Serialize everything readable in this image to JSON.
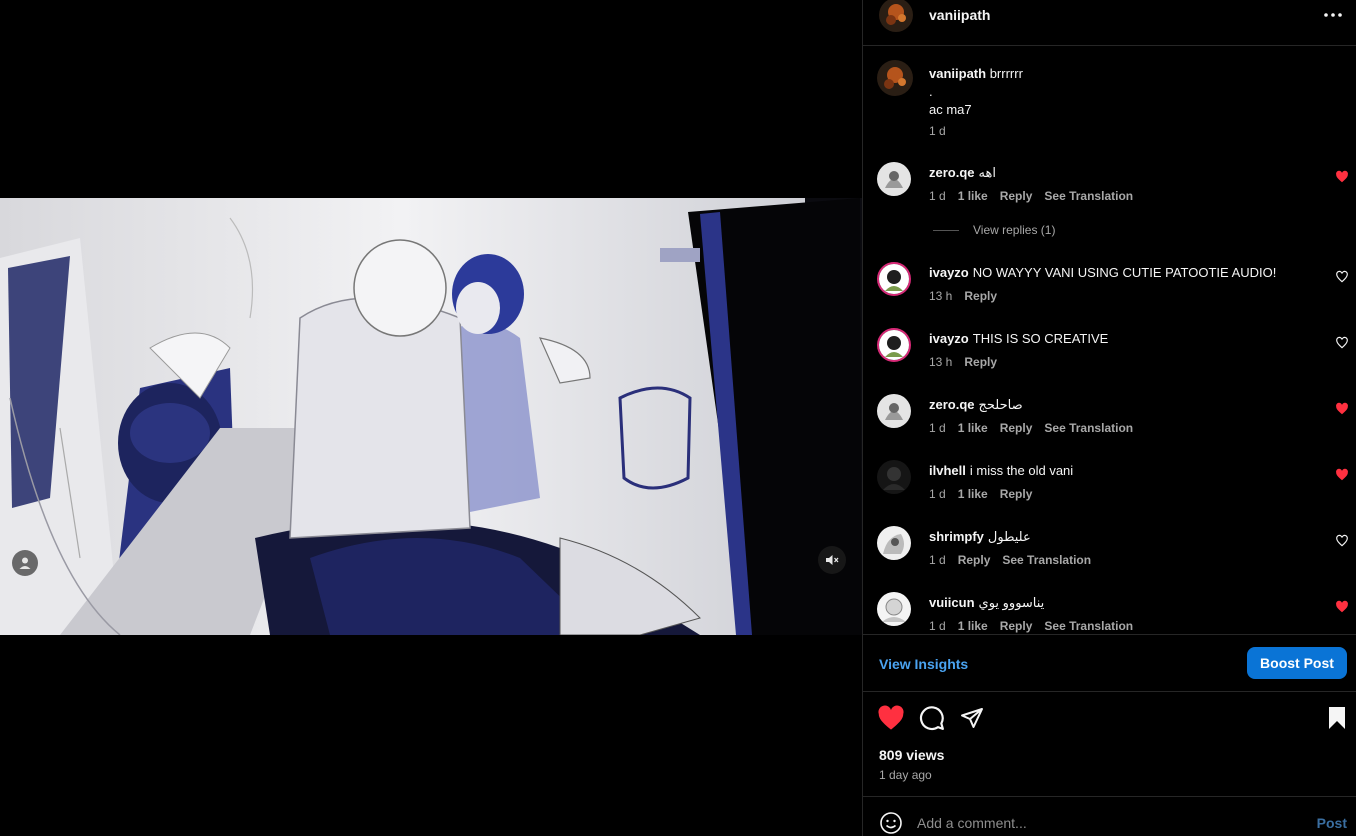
{
  "colors": {
    "background": "#000000",
    "accent_link": "#4aa3f0",
    "boost_button": "#0a74d6",
    "like_red": "#ff3040",
    "muted_text": "#a8a8a8",
    "divider": "#262626"
  },
  "post": {
    "author": "vaniipath",
    "more_icon": "more-horizontal-icon",
    "caption": {
      "user": "vaniipath",
      "line1": "brrrrrr",
      "line2": ".",
      "line3": "ac ma7",
      "time": "1 d"
    }
  },
  "media": {
    "tag_icon": "user-tag-icon",
    "mute_icon": "speaker-muted-icon"
  },
  "comments": [
    {
      "user": "zero.qe",
      "text": "اهه",
      "time": "1 d",
      "likes": "1 like",
      "reply": "Reply",
      "translate": "See Translation",
      "liked": true
    },
    {
      "user": "ivayzo",
      "text": "NO WAYYY VANI USING CUTIE PATOOTIE AUDIO!",
      "time": "13 h",
      "likes": "",
      "reply": "Reply",
      "translate": "",
      "liked": false
    },
    {
      "user": "ivayzo",
      "text": "THIS IS SO CREATIVE",
      "time": "13 h",
      "likes": "",
      "reply": "Reply",
      "translate": "",
      "liked": false
    },
    {
      "user": "zero.qe",
      "text": "صاحلحج",
      "time": "1 d",
      "likes": "1 like",
      "reply": "Reply",
      "translate": "See Translation",
      "liked": true
    },
    {
      "user": "ilvhell",
      "text": "i miss the old vani",
      "time": "1 d",
      "likes": "1 like",
      "reply": "Reply",
      "translate": "",
      "liked": true
    },
    {
      "user": "shrimpfy",
      "text": "عليطول",
      "time": "1 d",
      "likes": "",
      "reply": "Reply",
      "translate": "See Translation",
      "liked": false
    },
    {
      "user": "vuiicun",
      "text": "يناسووو يوي",
      "time": "1 d",
      "likes": "1 like",
      "reply": "Reply",
      "translate": "See Translation",
      "liked": true
    }
  ],
  "view_replies": "View replies (1)",
  "insights": {
    "view_insights": "View Insights",
    "boost_post": "Boost Post"
  },
  "actions": {
    "like_icon": "heart-filled-icon",
    "comment_icon": "comment-bubble-icon",
    "share_icon": "send-paper-plane-icon",
    "save_icon": "bookmark-filled-icon",
    "views": "809 views",
    "time_ago": "1 day ago"
  },
  "composer": {
    "emoji_icon": "emoji-smile-icon",
    "placeholder": "Add a comment...",
    "post_label": "Post"
  }
}
